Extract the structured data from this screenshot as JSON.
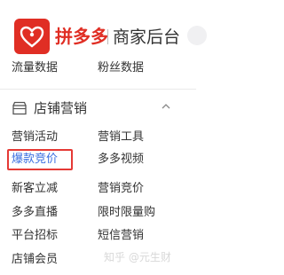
{
  "header": {
    "brand": "拼多多",
    "subtitle": "商家后台",
    "logo_icon": "pinduoduo-logo-icon",
    "brand_color": "#e02e24"
  },
  "data_section": {
    "items": [
      "流量数据",
      "粉丝数据"
    ]
  },
  "store_marketing": {
    "title": "店铺营销",
    "icon": "shop-icon",
    "expand_icon": "chevron-up-icon",
    "items": [
      "营销活动",
      "营销工具",
      "爆款竞价",
      "多多视频",
      "新客立减",
      "营销竞价",
      "多多直播",
      "限时限量购",
      "平台招标",
      "短信营销",
      "店铺会员"
    ],
    "active_item": "爆款竞价",
    "active_color": "#3b6fe0",
    "highlight_color": "#e53935"
  },
  "watermark": "知乎 @元生财"
}
